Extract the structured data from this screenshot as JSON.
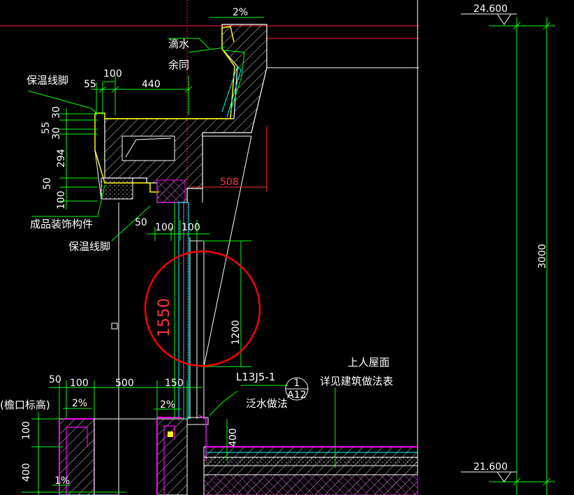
{
  "colors": {
    "background": "#000000",
    "dimension": "#00ff00",
    "wall": "#ffffff",
    "insulation": "#ffff00",
    "waterproof": "#ff00ff",
    "highlight_circle": "#ff0000",
    "window": "#00ffff",
    "red_dim": "#ff3333"
  },
  "levels": {
    "top": "24.600",
    "bottom": "21.600",
    "height": "3000"
  },
  "dimensions": {
    "d_2pct_top": "2%",
    "d_100_top": "100",
    "d_55": "55",
    "d_440": "440",
    "d_30a": "30",
    "d_55b": "55",
    "d_30b": "30",
    "d_294": "294",
    "d_50_left": "50",
    "d_100_left": "100",
    "d_508": "508",
    "d_50_mid": "50",
    "d_100_mid_a": "100",
    "d_100_mid_b": "100",
    "d_1550": "1550",
    "d_1200": "1200",
    "d_50_bot": "50",
    "d_100_bot": "100",
    "d_500_bot": "500",
    "d_150_bot": "150",
    "d_2pct_bl": "2%",
    "d_2pct_bm": "2%",
    "d_100_bl": "100",
    "d_400_bl": "400",
    "d_1pct": "1%",
    "d_400_br": "400"
  },
  "labels": {
    "drip": "滴水",
    "drip2": "余同",
    "insul_skirt_top": "保温线脚",
    "decor": "成品装饰构件",
    "insul_skirt_bot": "保温线脚",
    "eave": "(檐口标高)",
    "roof_title": "上人屋面",
    "roof_note": "详见建筑做法表",
    "spec": "L13J5-1",
    "flashing": "泛水做法",
    "callout_num": "1",
    "callout_sheet": "A12"
  }
}
